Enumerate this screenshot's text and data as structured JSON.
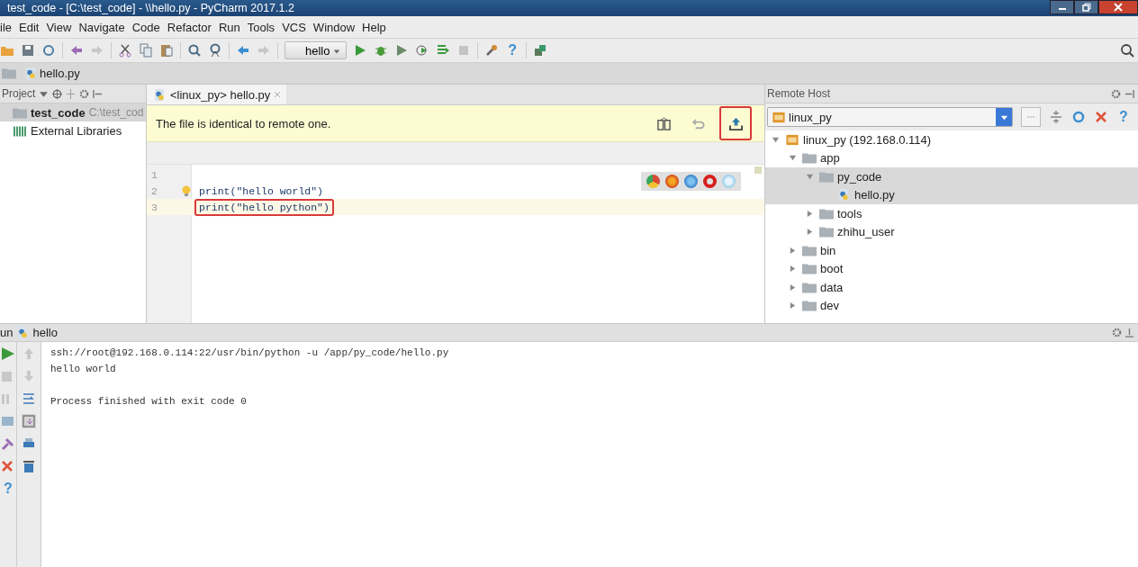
{
  "window": {
    "title": "test_code - [C:\\test_code] - \\\\hello.py - PyCharm 2017.1.2"
  },
  "menu": [
    "ile",
    "Edit",
    "View",
    "Navigate",
    "Code",
    "Refactor",
    "Run",
    "Tools",
    "VCS",
    "Window",
    "Help"
  ],
  "toolbar": {
    "run_config": "hello",
    "help": "?"
  },
  "breadcrumb": [
    "hello.py"
  ],
  "project": {
    "title": "Project",
    "items": [
      {
        "name": "test_code",
        "path": "C:\\test_cod",
        "kind": "folder",
        "selected": true
      },
      {
        "name": "External Libraries",
        "kind": "library",
        "selected": false
      }
    ]
  },
  "editor": {
    "tabs": [
      {
        "label": "<linux_py> hello.py",
        "selected": true
      }
    ],
    "notice": "The file is identical to remote one.",
    "actions": [
      {
        "kind": "compare",
        "annotated": false
      },
      {
        "kind": "revert",
        "annotated": false
      },
      {
        "kind": "upload",
        "annotated": true
      }
    ],
    "lines": [
      {
        "number": "1",
        "current": false
      },
      {
        "number": "2",
        "code": "print(\"hello world\")",
        "current": false,
        "annotated": false
      },
      {
        "number": "3",
        "code": "print(\"hello python\")",
        "current": true,
        "annotated": true
      }
    ]
  },
  "remote": {
    "title": "Remote Host",
    "host": "linux_py",
    "help": "?",
    "tree": [
      {
        "label": "linux_py (192.168.0.114)",
        "kind": "host",
        "expanded": true,
        "selected": false,
        "children": [
          {
            "label": "app",
            "kind": "folder",
            "expanded": true,
            "selected": false,
            "children": [
              {
                "label": "py_code",
                "kind": "folder",
                "expanded": true,
                "selected": true,
                "children": [
                  {
                    "label": "hello.py",
                    "kind": "file",
                    "selected": true
                  }
                ]
              },
              {
                "label": "tools",
                "kind": "folder",
                "expanded": false,
                "selected": false
              },
              {
                "label": "zhihu_user",
                "kind": "folder",
                "expanded": false,
                "selected": false
              }
            ]
          },
          {
            "label": "bin",
            "kind": "folder",
            "expanded": false,
            "selected": false
          },
          {
            "label": "boot",
            "kind": "folder",
            "expanded": false,
            "selected": false
          },
          {
            "label": "data",
            "kind": "folder",
            "expanded": false,
            "selected": false
          },
          {
            "label": "dev",
            "kind": "folder",
            "expanded": false,
            "selected": false
          }
        ]
      }
    ]
  },
  "run": {
    "tab_prefix": "un",
    "config": "hello",
    "help": "?",
    "output": [
      "ssh://root@192.168.0.114:22/usr/bin/python -u /app/py_code/hello.py",
      "hello world"
    ],
    "exit_message": "Process finished with exit code 0"
  }
}
